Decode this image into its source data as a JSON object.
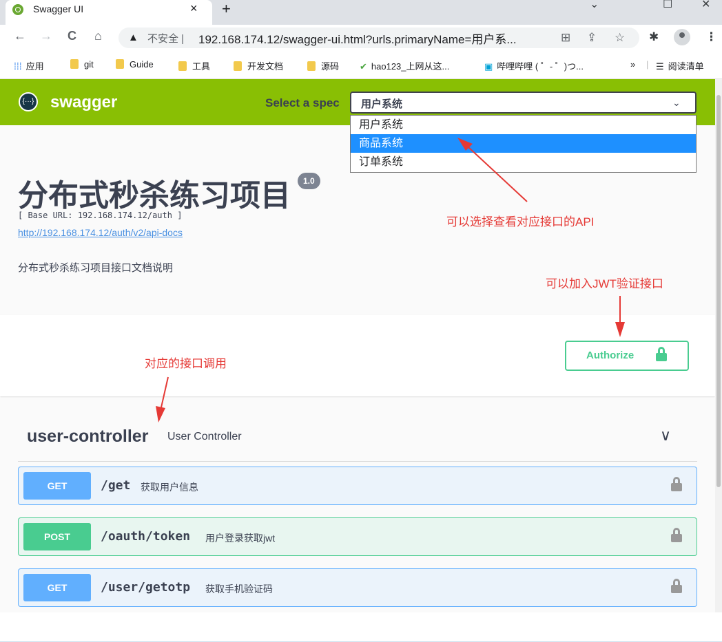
{
  "browser": {
    "tab_title": "Swagger UI",
    "tab_close": "×",
    "new_tab": "+",
    "win_min": "⌄",
    "win_max": "☐",
    "win_close": "✕",
    "back": "←",
    "forward": "→",
    "reload": "C",
    "home": "⌂",
    "security_icon": "▲",
    "insecure_label": "不安全 |",
    "url": "192.168.174.12/swagger-ui.html?urls.primaryName=用户系...",
    "translate_icon": "⊞",
    "share_icon": "⇪",
    "star_icon": "☆",
    "extensions_icon": "✱",
    "menu_icon": "⋮"
  },
  "bookmarks": {
    "apps": "应用",
    "items": [
      "git",
      "Guide",
      "工具",
      "开发文档",
      "源码"
    ],
    "hao123": "hao123_上网从这...",
    "bilibili": "哔哩哔哩 ( ゜- ゜)つ...",
    "overflow": "»",
    "reading_list": "阅读清单"
  },
  "swagger": {
    "logo_text": "swagger",
    "select_spec_label": "Select a spec",
    "selected_spec": "用户系统",
    "spec_options": [
      "用户系统",
      "商品系统",
      "订单系统"
    ],
    "highlighted_option_index": 1
  },
  "info": {
    "title": "分布式秒杀练习项目",
    "version": "1.0",
    "base_url": "[ Base URL: 192.168.174.12/auth ]",
    "api_docs_link": "http://192.168.174.12/auth/v2/api-docs",
    "description": "分布式秒杀练习项目接口文档说明"
  },
  "annotations": {
    "select_spec_note": "可以选择查看对应接口的API",
    "jwt_note": "可以加入JWT验证接口",
    "ops_note": "对应的接口调用"
  },
  "authorize": {
    "label": "Authorize"
  },
  "tag": {
    "name": "user-controller",
    "description": "User Controller",
    "toggle": "∨"
  },
  "operations": [
    {
      "method": "GET",
      "path": "/get",
      "summary": "获取用户信息"
    },
    {
      "method": "POST",
      "path": "/oauth/token",
      "summary": "用户登录获取jwt"
    },
    {
      "method": "GET",
      "path": "/user/getotp",
      "summary": "获取手机验证码"
    }
  ],
  "colors": {
    "topbar": "#89bf04",
    "get": "#61affe",
    "post": "#49cc90",
    "annotation": "#e53935",
    "selected_option": "#1e90ff"
  }
}
